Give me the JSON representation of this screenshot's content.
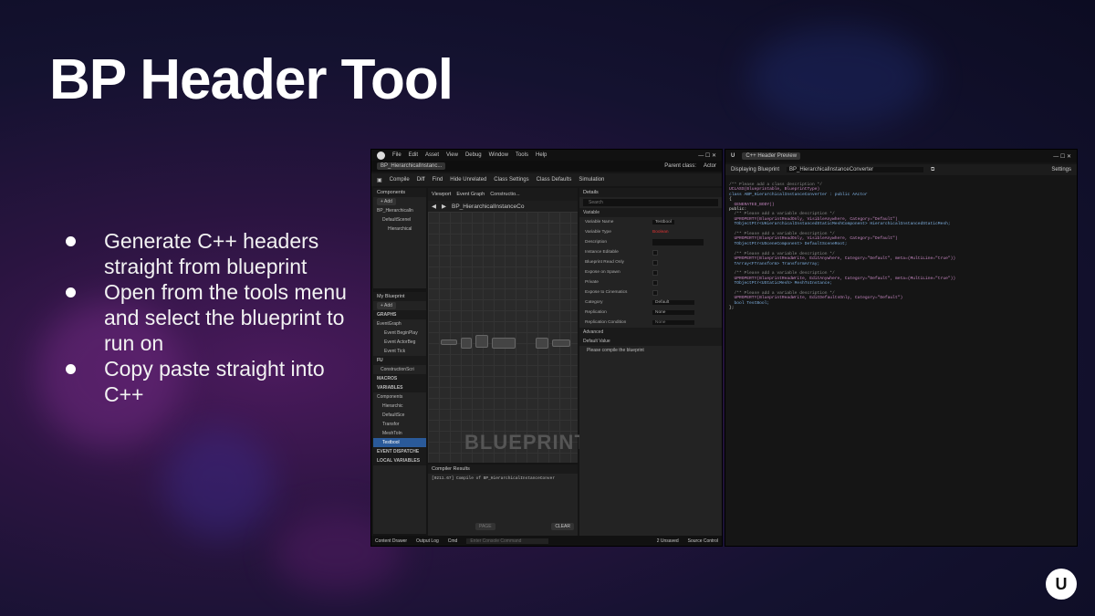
{
  "slide": {
    "title": "BP Header Tool",
    "bullets": [
      "Generate C++ headers straight from blueprint",
      "Open from the tools menu and select the blueprint to run on",
      "Copy paste straight into C++"
    ]
  },
  "editor": {
    "menu": [
      "File",
      "Edit",
      "Asset",
      "View",
      "Debug",
      "Window",
      "Tools",
      "Help"
    ],
    "tab": "BP_HierarchicalInstanc...",
    "parent_class_label": "Parent class:",
    "parent_class": "Actor",
    "toolbar": [
      "Compile",
      "Diff",
      "Find",
      "Hide Unrelated",
      "Class Settings",
      "Class Defaults",
      "Simulation"
    ],
    "components_title": "Components",
    "add_label": "+ Add",
    "components": [
      "BP_Hierarchicalln",
      "DefaultScenel",
      "Hierarchical"
    ],
    "graph_tabs": [
      "Viewport",
      "Event Graph",
      "Constructio..."
    ],
    "breadcrumb": "BP_HierarchicalInstanceCo",
    "my_blueprint_title": "My Blueprint",
    "sections": {
      "graphs": "GRAPHS",
      "event_graph": "EventGraph",
      "events": [
        "Event BeginPlay",
        "Event ActorBeg",
        "Event Tick"
      ],
      "fn": "FU",
      "construction": "ConstructionScri",
      "macros": "MACROS",
      "variables": "VARIABLES",
      "components": "Components",
      "vars": [
        "Hierarchic",
        "DefaultSce",
        "Transfor",
        "MeshToIn",
        "Testbool"
      ],
      "dispatchers": "EVENT DISPATCHE",
      "local_vars": "LOCAL VARIABLES"
    },
    "watermark": "BLUEPRINT",
    "details_title": "Details",
    "search_placeholder": "Search",
    "variable_section": "Variable",
    "details": [
      {
        "label": "Variable Name",
        "value": "Testbool"
      },
      {
        "label": "Variable Type",
        "value": "Boolean"
      },
      {
        "label": "Description",
        "value": ""
      },
      {
        "label": "Instance Editable",
        "value": ""
      },
      {
        "label": "Blueprint Read Only",
        "value": ""
      },
      {
        "label": "Expose on Spawn",
        "value": ""
      },
      {
        "label": "Private",
        "value": ""
      },
      {
        "label": "Expose to Cinematics",
        "value": ""
      },
      {
        "label": "Category",
        "value": "Default"
      },
      {
        "label": "Replication",
        "value": "None"
      },
      {
        "label": "Replication Condition",
        "value": "None"
      }
    ],
    "advanced": "Advanced",
    "default_value": "Default Value",
    "compile_note": "Please compile the blueprint",
    "compiler_title": "Compiler Results",
    "compiler_line": "[0211.67] Compile of BP_HierarchicalInstanceConver",
    "page_btn": "PAGE",
    "clear_btn": "CLEAR",
    "status": [
      "Content Drawer",
      "Output Log",
      "Cmd",
      "Enter Console Command",
      "2 Unsaved",
      "Source Control"
    ]
  },
  "header_preview": {
    "title": "C++ Header Preview",
    "displaying_label": "Displaying Blueprint",
    "blueprint": "BP_HierarchicalInstanceConverter",
    "settings": "Settings",
    "code": [
      "/** Please add a class description */",
      "UCLASS(Blueprintable, BlueprintType)",
      "class ABP_HierarchicalInstanceConverter : public AActor",
      "{",
      "  GENERATED_BODY()",
      "public:",
      "  /** Please add a variable description */",
      "  UPROPERTY(BlueprintReadOnly, VisibleAnywhere, Category=\"Default\")",
      "  TObjectPtr<UHierarchicalInstancedStaticMeshComponent> HierarchicalInstancedStaticMesh;",
      "",
      "  /** Please add a variable description */",
      "  UPROPERTY(BlueprintReadOnly, VisibleAnywhere, Category=\"Default\")",
      "  TObjectPtr<USceneComponent> DefaultSceneRoot;",
      "",
      "  /** Please add a variable description */",
      "  UPROPERTY(BlueprintReadWrite, EditAnywhere, Category=\"Default\", meta=(MultiLine=\"true\"))",
      "  TArray<FTransform> TransformArray;",
      "",
      "  /** Please add a variable description */",
      "  UPROPERTY(BlueprintReadWrite, EditAnywhere, Category=\"Default\", meta=(MultiLine=\"true\"))",
      "  TObjectPtr<UStaticMesh> MeshToInstance;",
      "",
      "  /** Please add a variable description */",
      "  UPROPERTY(BlueprintReadWrite, EditDefaultsOnly, Category=\"Default\")",
      "  bool TestBool;",
      "};"
    ]
  },
  "logo": "U"
}
